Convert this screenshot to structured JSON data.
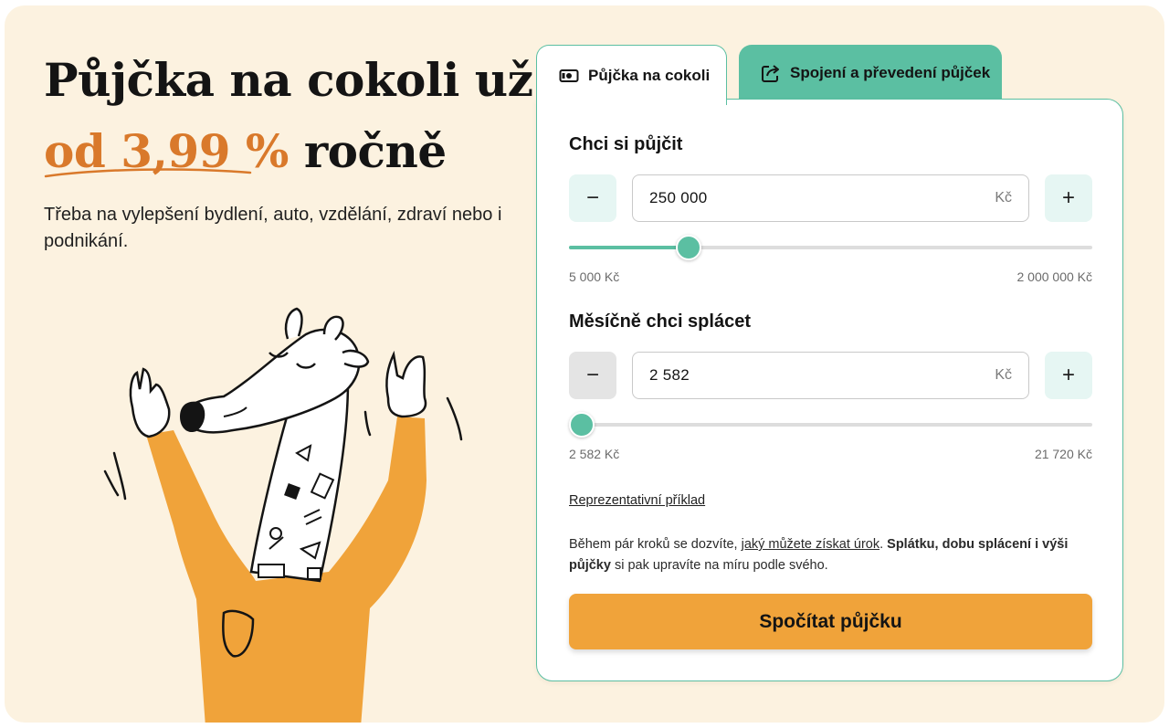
{
  "hero": {
    "title_line1": "Půjčka na cokoli už",
    "title_accent": "od 3,99 %",
    "title_line2_rest": "ročně",
    "subtitle": "Třeba na vylepšení bydlení, auto, vzdělání, zdraví nebo i podnikání."
  },
  "tabs": [
    {
      "label": "Půjčka na cokoli",
      "icon": "money-bill-icon",
      "active": true
    },
    {
      "label": "Spojení a převedení půjček",
      "icon": "share-arrow-icon",
      "active": false
    }
  ],
  "calculator": {
    "loan": {
      "label": "Chci si půjčit",
      "value": "250 000",
      "unit": "Kč",
      "min_label": "5 000 Kč",
      "max_label": "2 000 000 Kč",
      "slider_fraction": 0.214
    },
    "monthly": {
      "label": "Měsíčně chci splácet",
      "value": "2 582",
      "unit": "Kč",
      "min_label": "2 582 Kč",
      "max_label": "21 720 Kč",
      "slider_fraction": 0.0
    },
    "minus_symbol": "−",
    "plus_symbol": "+",
    "representative_link": "Reprezentativní příklad",
    "info": {
      "part1": "Během pár kroků se dozvíte, ",
      "link": "jaký můžete získat úrok",
      "part2": ". ",
      "bold": "Splátku, dobu splácení i výši půjčky",
      "part3": " si pak upravíte na míru podle svého."
    },
    "cta_label": "Spočítat půjčku"
  },
  "colors": {
    "background": "#fcf2e0",
    "accent_orange": "#d9792b",
    "teal": "#5bbfa2",
    "cta": "#f0a33a"
  }
}
